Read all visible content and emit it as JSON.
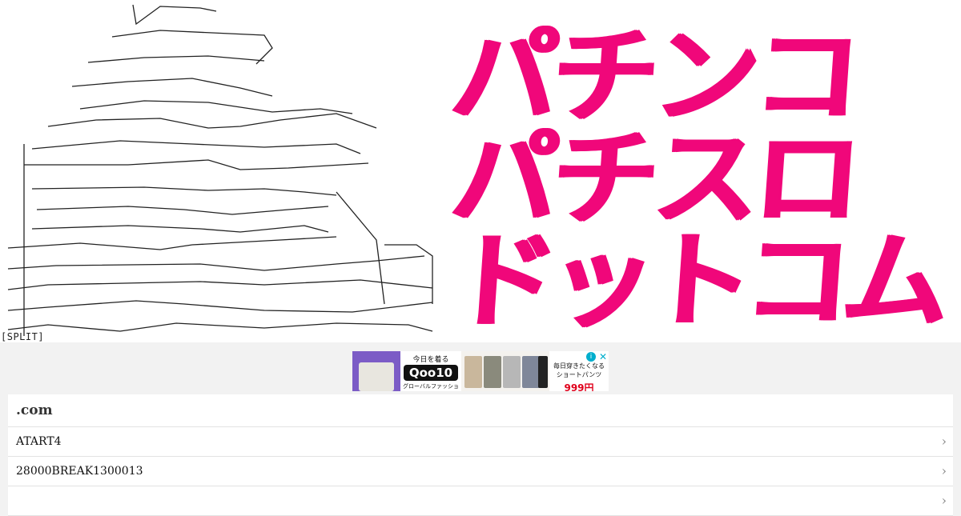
{
  "header": {
    "ascii_art_footer": "[SPLIT]",
    "logo": {
      "line1": "パチンコ",
      "line2": "パチスロ",
      "line3": "ドットコム",
      "color": "#f0077a"
    }
  },
  "ad": {
    "brand_top": "今日を着る",
    "brand_main": "Qoo10",
    "brand_sub": "グローバルファッション",
    "promo_line1": "毎日穿きたくなる",
    "promo_line2": "ショートパンツ",
    "price": "999円",
    "info_icon": "info-icon",
    "close_icon": "close-icon"
  },
  "list": {
    "title": ".com",
    "items": [
      {
        "label": "ATART4"
      },
      {
        "label": "28000BREAK1300013"
      },
      {
        "label": ""
      }
    ]
  }
}
